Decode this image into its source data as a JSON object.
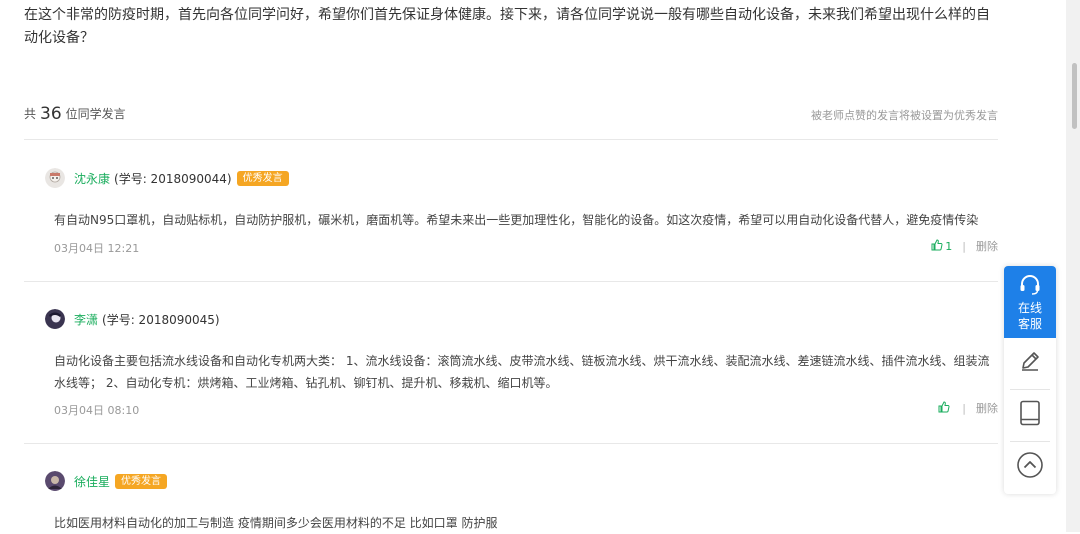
{
  "question": "在这个非常的防疫时期，首先向各位同学问好，希望你们首先保证身体健康。接下来，请各位同学说说一般有哪些自动化设备，未来我们希望出现什么样的自动化设备？",
  "summary": {
    "prefix": "共",
    "count": "36",
    "suffix": "位同学发言",
    "hint": "被老师点赞的发言将被设置为优秀发言"
  },
  "posts": [
    {
      "name": "沈永康",
      "student_id": "(学号: 2018090044)",
      "badge": "优秀发言",
      "text": "有自动N95口罩机，自动贴标机，自动防护服机，碾米机，磨面机等。希望未来出一些更加理性化，智能化的设备。如这次疫情，希望可以用自动化设备代替人，避免疫情传染",
      "date": "03月04日 12:21",
      "likes": "1",
      "separator": "|",
      "delete": "删除"
    },
    {
      "name": "李潇",
      "student_id": "(学号: 2018090045)",
      "badge": "",
      "text": "自动化设备主要包括流水线设备和自动化专机两大类： 1、流水线设备：滚筒流水线、皮带流水线、链板流水线、烘干流水线、装配流水线、差速链流水线、插件流水线、组装流水线等； 2、自动化专机：烘烤箱、工业烤箱、钻孔机、铆钉机、提升机、移栽机、缩口机等。",
      "date": "03月04日 08:10",
      "likes": "",
      "separator": "|",
      "delete": "删除"
    },
    {
      "name": "徐佳星",
      "student_id": "",
      "badge": "优秀发言",
      "text": "比如医用材料自动化的加工与制造 疫情期间多少会医用材料的不足 比如口罩 防护服"
    }
  ],
  "float_bar": {
    "service_line1": "在线",
    "service_line2": "客服",
    "items": [
      "edit-icon",
      "tablet-icon",
      "back-to-top-icon"
    ]
  },
  "colors": {
    "accent_green": "#1aad5d",
    "badge_orange": "#f5a623",
    "service_blue": "#1e80e8"
  }
}
